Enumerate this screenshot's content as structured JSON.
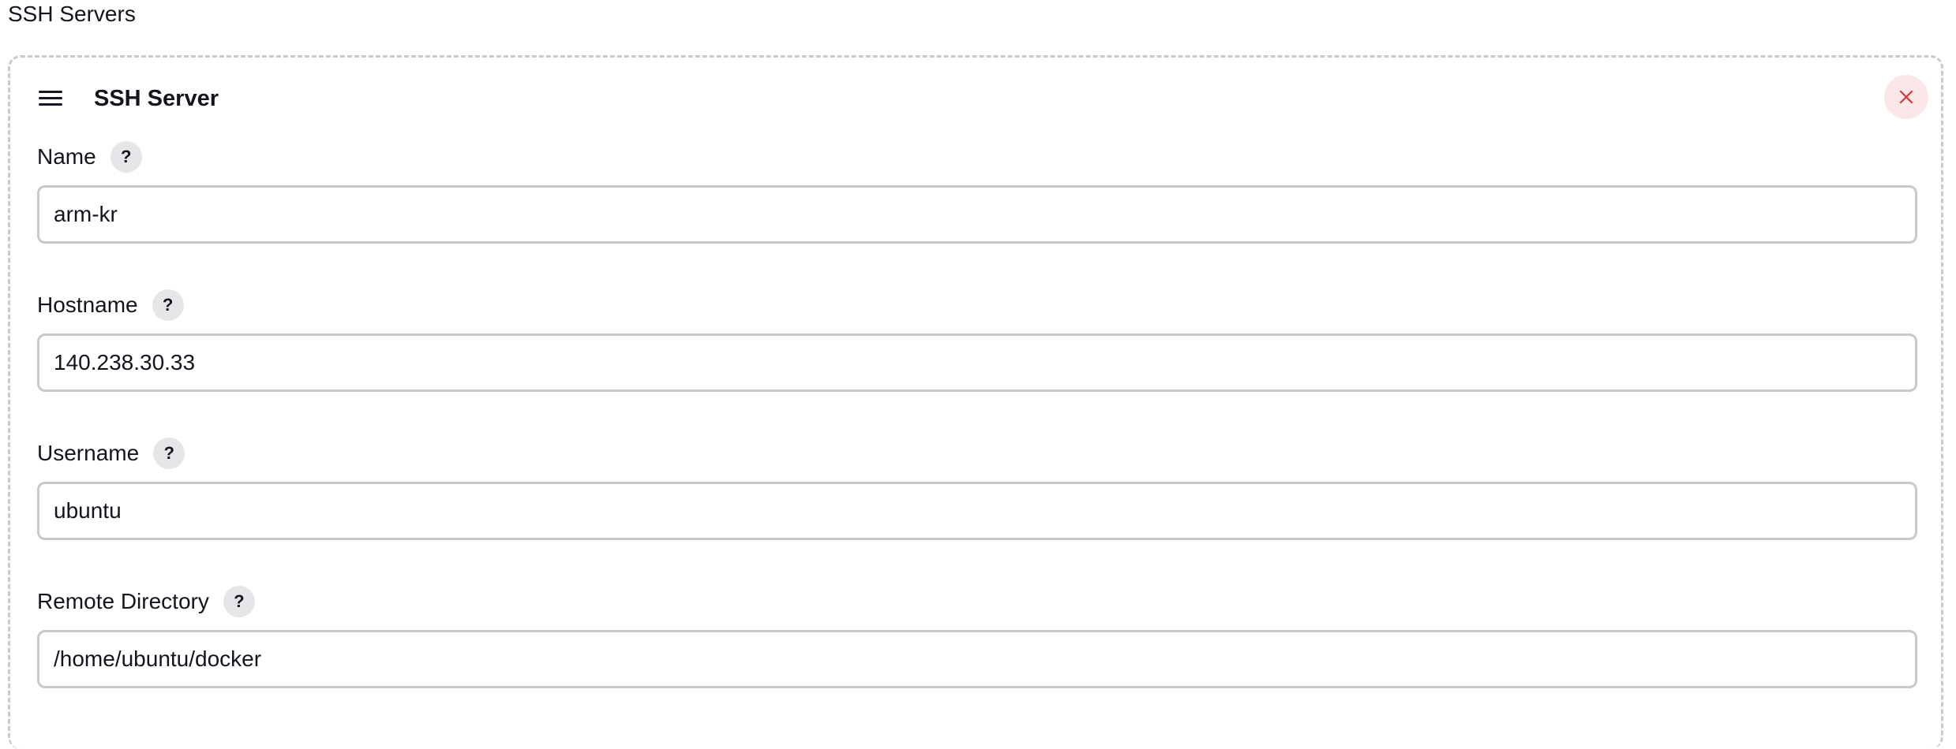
{
  "section": {
    "title": "SSH Servers"
  },
  "server_card": {
    "title": "SSH Server",
    "drag_icon": "hamburger-menu-icon",
    "close_icon": "close-x-icon",
    "close_color": "#d33833",
    "fields": [
      {
        "label": "Name",
        "help": "?",
        "value": "arm-kr"
      },
      {
        "label": "Hostname",
        "help": "?",
        "value": "140.238.30.33"
      },
      {
        "label": "Username",
        "help": "?",
        "value": "ubuntu"
      },
      {
        "label": "Remote Directory",
        "help": "?",
        "value": "/home/ubuntu/docker"
      }
    ]
  }
}
